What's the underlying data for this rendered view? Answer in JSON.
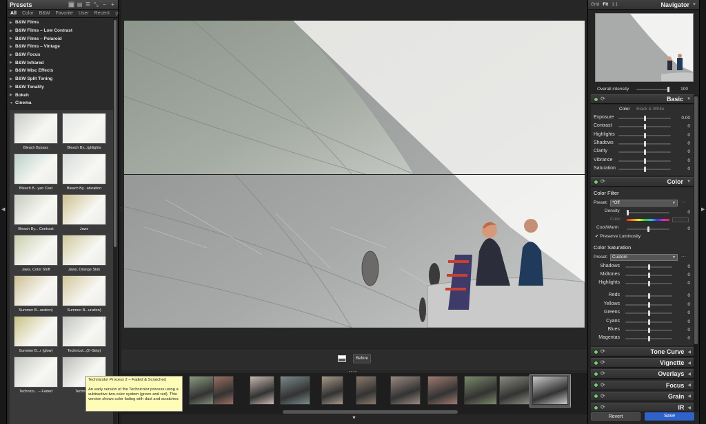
{
  "left_panel": {
    "title": "Presets",
    "filter_tabs": [
      "All",
      "Color",
      "B&W",
      "Favorite",
      "User",
      "Recent"
    ],
    "categories": [
      {
        "label": "B&W Films",
        "expanded": false
      },
      {
        "label": "B&W Films – Low Contrast",
        "expanded": false
      },
      {
        "label": "B&W Films – Polaroid",
        "expanded": false
      },
      {
        "label": "B&W Films – Vintage",
        "expanded": false
      },
      {
        "label": "B&W Focus",
        "expanded": false
      },
      {
        "label": "B&W Infrared",
        "expanded": false
      },
      {
        "label": "B&W Misc Effects",
        "expanded": false
      },
      {
        "label": "B&W Split Toning",
        "expanded": false
      },
      {
        "label": "B&W Tonality",
        "expanded": false
      },
      {
        "label": "Bokeh",
        "expanded": false
      },
      {
        "label": "Cinema",
        "expanded": true
      }
    ],
    "preset_thumbs": [
      {
        "label": "Bleach Bypass",
        "tint": "#c9ccc6"
      },
      {
        "label": "Bleach By...ighlights",
        "tint": "#e4e7e6"
      },
      {
        "label": "Bleach B...yan Cast",
        "tint": "#b9d0c8"
      },
      {
        "label": "Bleach By...aturation",
        "tint": "#d6dbd8"
      },
      {
        "label": "Bleach By... Contrast",
        "tint": "#c5c9be"
      },
      {
        "label": "Jaws",
        "tint": "#cbbf8e"
      },
      {
        "label": "Jaws, Color Shift",
        "tint": "#c7cfac"
      },
      {
        "label": "Jaws, Orange Skin",
        "tint": "#cfc89a"
      },
      {
        "label": "Summer B...uration)",
        "tint": "#cdbf95"
      },
      {
        "label": "Summer B...uration)",
        "tint": "#d2c69c"
      },
      {
        "label": "Summer B...r (glow)",
        "tint": "#c7c286"
      },
      {
        "label": "Technicol...(2–Strip)",
        "tint": "#bfc3bf"
      },
      {
        "label": "Technico... – Faded",
        "tint": "#c4c7c3"
      },
      {
        "label": "Technico...",
        "tint": "#b9bcb9"
      }
    ]
  },
  "tooltip": {
    "title": "Technicolor Process 2 – Faded & Scratched",
    "body": "An early version of the Technicolor process using a subtractive two-color system (green and red). This version shows color fading with dust and scratches."
  },
  "toolbar": {
    "before_label": "Before"
  },
  "filmstrip": [
    {
      "tint": "#8a9a80"
    },
    {
      "tint": "#9a7060"
    },
    {
      "tint": "#c8b8b0"
    },
    {
      "tint": "#7a8a8a"
    },
    {
      "tint": "#a89888"
    },
    {
      "tint": "#8a7a6a"
    },
    {
      "tint": "#9a8a80"
    },
    {
      "tint": "#a07a70"
    },
    {
      "tint": "#7a8a6a"
    },
    {
      "tint": "#8a8a80"
    },
    {
      "tint": "#c8c8c8"
    },
    {
      "tint": "#6a7a8a"
    },
    {
      "tint": "#8a7a70"
    }
  ],
  "right_panel": {
    "zoom_options": [
      "Grid",
      "Fit",
      "1:1"
    ],
    "active_zoom": "Fit",
    "navigator_title": "Navigator",
    "overall_intensity": {
      "label": "Overall intensity",
      "value": "100",
      "level": 1.0
    },
    "basic": {
      "title": "Basic",
      "tabs": [
        "Color",
        "Black & White"
      ],
      "sliders": [
        {
          "label": "Exposure",
          "value": "0.00",
          "level": 0.5
        },
        {
          "label": "Contrast",
          "value": "0",
          "level": 0.5
        },
        {
          "label": "Highlights",
          "value": "0",
          "level": 0.5
        },
        {
          "label": "Shadows",
          "value": "0",
          "level": 0.5
        },
        {
          "label": "Clarity",
          "value": "0",
          "level": 0.5
        },
        {
          "label": "Vibrance",
          "value": "0",
          "level": 0.5
        },
        {
          "label": "Saturation",
          "value": "0",
          "level": 0.5
        }
      ]
    },
    "color": {
      "title": "Color",
      "color_filter_title": "Color Filter",
      "preset_label": "Preset:",
      "filter_preset": "*Off",
      "density": {
        "label": "Density",
        "value": "0",
        "level": 0.0
      },
      "color_label": "Color",
      "cool_warm": {
        "label": "Cool/Warm",
        "value": "0",
        "level": 0.5
      },
      "preserve_luminosity": "Preserve Luminosity",
      "saturation_title": "Color Saturation",
      "saturation_preset": "Custom",
      "sliders": [
        {
          "label": "Shadows",
          "value": "0",
          "level": 0.5
        },
        {
          "label": "Midtones",
          "value": "0",
          "level": 0.5
        },
        {
          "label": "Highlights",
          "value": "0",
          "level": 0.5
        },
        {
          "label": "Reds",
          "value": "0",
          "level": 0.5
        },
        {
          "label": "Yellows",
          "value": "0",
          "level": 0.5
        },
        {
          "label": "Greens",
          "value": "0",
          "level": 0.5
        },
        {
          "label": "Cyans",
          "value": "0",
          "level": 0.5
        },
        {
          "label": "Blues",
          "value": "0",
          "level": 0.5
        },
        {
          "label": "Magentas",
          "value": "0",
          "level": 0.5
        }
      ]
    },
    "collapsed_sections": [
      "Tone Curve",
      "Vignette",
      "Overlays",
      "Focus",
      "Grain",
      "IR"
    ],
    "revert_label": "Revert",
    "save_label": "Save",
    "save_color": "#2f63c9"
  }
}
